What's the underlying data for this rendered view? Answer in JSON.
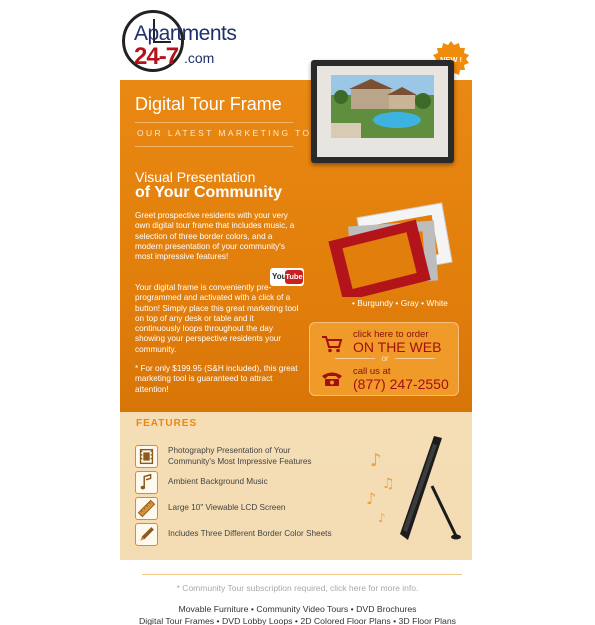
{
  "logo": {
    "name_line": "Apartments",
    "number_line": "24-7",
    "domain_suffix": ".com"
  },
  "hero": {
    "title": "Digital Tour Frame",
    "subtitle": "OUR LATEST MARKETING TOOL",
    "headline_line1": "Visual Presentation",
    "headline_line2": "of Your Community",
    "paragraph1": "Greet prospective residents with your very own digital tour frame that includes music, a selection of three border colors, and a modern presentation of your community's most impressive features!",
    "paragraph2": "Your digital frame is conveniently pre-programmed and activated with a click of a button!  Simply place this great marketing tool on top of any desk or table and it continuously loops throughout the day showing your perspective residents your community.",
    "paragraph3": "* For only $199.95 (S&H included), this great marketing tool is guaranteed to attract attention!",
    "youtube_you": "You",
    "youtube_tube": "Tube",
    "new_badge": "NEW !",
    "border_colors": "• Burgundy   • Gray   • White"
  },
  "order": {
    "web_line1": "click here to order",
    "web_line2": "ON THE WEB",
    "or_text": "or",
    "phone_line1": "call us at",
    "phone_line2": "(877) 247-2550"
  },
  "features": {
    "title": "FEATURES",
    "items": [
      {
        "line1": "Photography Presentation of Your",
        "line2": "Community's Most Impressive Features",
        "icon": "film-strip-icon"
      },
      {
        "line1": "Ambient Background Music",
        "line2": "",
        "icon": "music-note-icon"
      },
      {
        "line1": "Large 10\" Viewable LCD Screen",
        "line2": "",
        "icon": "ruler-icon"
      },
      {
        "line1": "Includes Three Different Border Color Sheets",
        "line2": "",
        "icon": "pencil-icon"
      }
    ]
  },
  "footer": {
    "note": "* Community Tour subscription required, click here for more info.",
    "links_line1": "Movable Furniture • Community Video Tours • DVD Brochures",
    "links_line2": "Digital Tour Frames • DVD Lobby Loops • 2D Colored Floor Plans • 3D Floor Plans"
  },
  "colors": {
    "hero_orange": "#e98812",
    "features_bg": "#f5deb6",
    "logo_blue": "#1e2f6b",
    "logo_red": "#b5121b",
    "order_red": "#a20f12"
  }
}
